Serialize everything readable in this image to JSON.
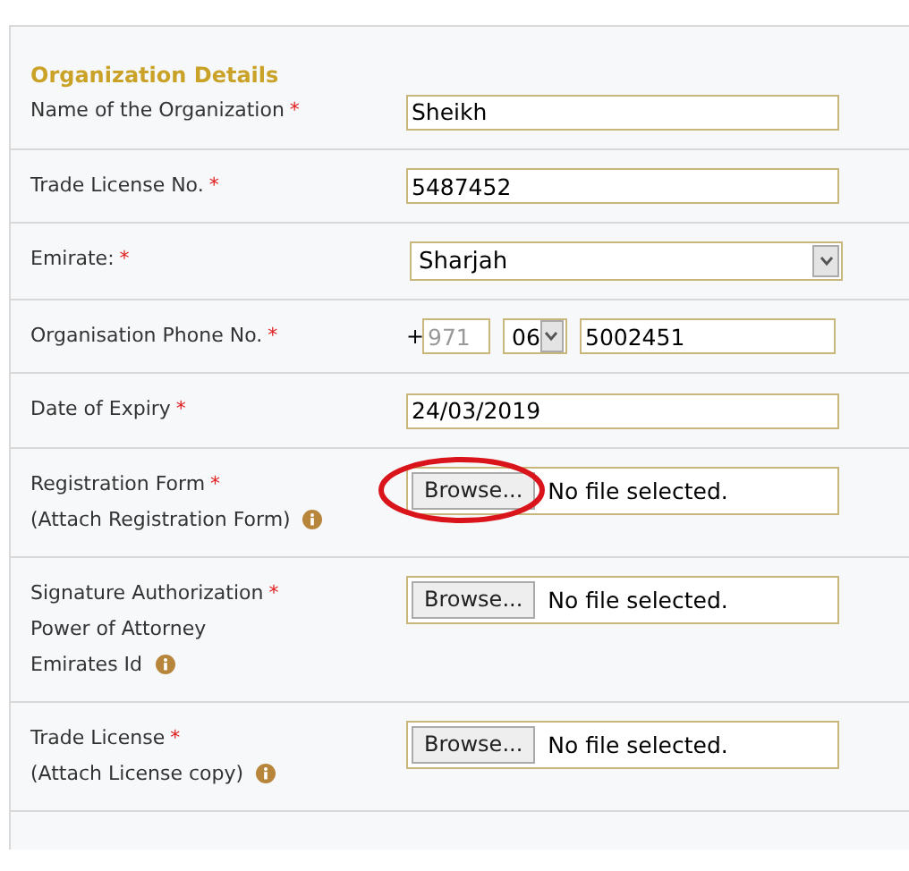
{
  "section": {
    "heading": "Organization Details"
  },
  "rows": [
    {
      "kind": "text",
      "label": [
        {
          "text": "Name of the Organization",
          "mark": "*"
        }
      ],
      "value": "Sheikh"
    },
    {
      "kind": "text",
      "label": [
        {
          "text": "Trade License No.",
          "mark": "*"
        }
      ],
      "value": "5487452"
    },
    {
      "kind": "select",
      "label": [
        {
          "text": "Emirate:",
          "mark": "*"
        }
      ],
      "value": "Sharjah"
    },
    {
      "kind": "phone",
      "label": [
        {
          "text": "Organisation Phone No.",
          "mark": "*"
        }
      ],
      "prefix": "+",
      "country_code": "971",
      "area_code": "06",
      "value": "5002451"
    },
    {
      "kind": "text",
      "label": [
        {
          "text": "Date of Expiry",
          "mark": "*"
        }
      ],
      "value": "24/03/2019"
    },
    {
      "kind": "file",
      "label": [
        {
          "text": "Registration Form",
          "mark": "*"
        },
        {
          "text": "(Attach Registration Form)",
          "info": true
        }
      ],
      "button": "Browse...",
      "status": "No file selected.",
      "circled": true
    },
    {
      "kind": "file",
      "label": [
        {
          "text": "Signature Authorization",
          "mark": "*"
        },
        {
          "text": "Power of Attorney"
        },
        {
          "text": "Emirates Id",
          "info": true
        }
      ],
      "button": "Browse...",
      "status": "No file selected.",
      "circled": false
    },
    {
      "kind": "file",
      "label": [
        {
          "text": "Trade License",
          "mark": "*"
        },
        {
          "text": "(Attach License copy)",
          "info": true
        }
      ],
      "button": "Browse...",
      "status": "No file selected.",
      "circled": false
    }
  ]
}
